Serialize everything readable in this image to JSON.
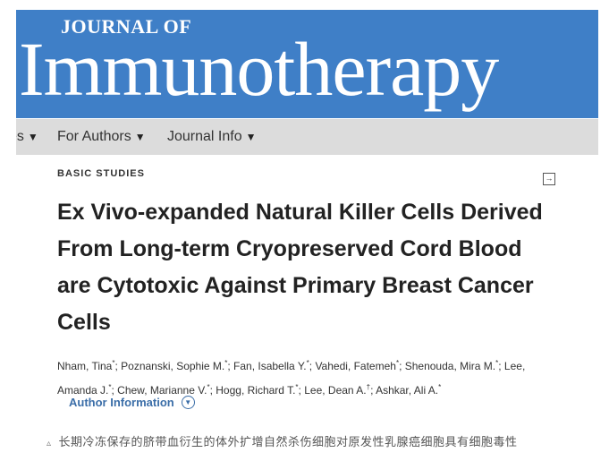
{
  "header": {
    "journal_prefix": "JOURNAL OF",
    "journal_name": "Immunotherapy"
  },
  "nav": {
    "items": [
      {
        "label": "es"
      },
      {
        "label": "For Authors"
      },
      {
        "label": "Journal Info"
      }
    ],
    "chevron": "chevron-down-icon"
  },
  "article": {
    "category": "BASIC STUDIES",
    "title": "Ex Vivo-expanded Natural Killer Cells Derived From Long-term Cryopreserved Cord Blood are Cytotoxic Against Primary Breast Cancer Cells",
    "authors": [
      {
        "name": "Nham, Tina",
        "mark": "*"
      },
      {
        "name": "Poznanski, Sophie M.",
        "mark": "*"
      },
      {
        "name": "Fan, Isabella Y.",
        "mark": "*"
      },
      {
        "name": "Vahedi, Fatemeh",
        "mark": "*"
      },
      {
        "name": "Shenouda, Mira M.",
        "mark": "*"
      },
      {
        "name": "Lee, Amanda J.",
        "mark": "*"
      },
      {
        "name": "Chew, Marianne V.",
        "mark": "*"
      },
      {
        "name": "Hogg, Richard T.",
        "mark": "*"
      },
      {
        "name": "Lee, Dean A.",
        "mark": "†"
      },
      {
        "name": "Ashkar, Ali A.",
        "mark": "*"
      }
    ],
    "author_info_label": "Author Information",
    "export_icon": "export-icon"
  },
  "caption": {
    "marker": "▵",
    "text": "长期冷冻保存的脐带血衍生的体外扩增自然杀伤细胞对原发性乳腺癌细胞具有细胞毒性"
  }
}
